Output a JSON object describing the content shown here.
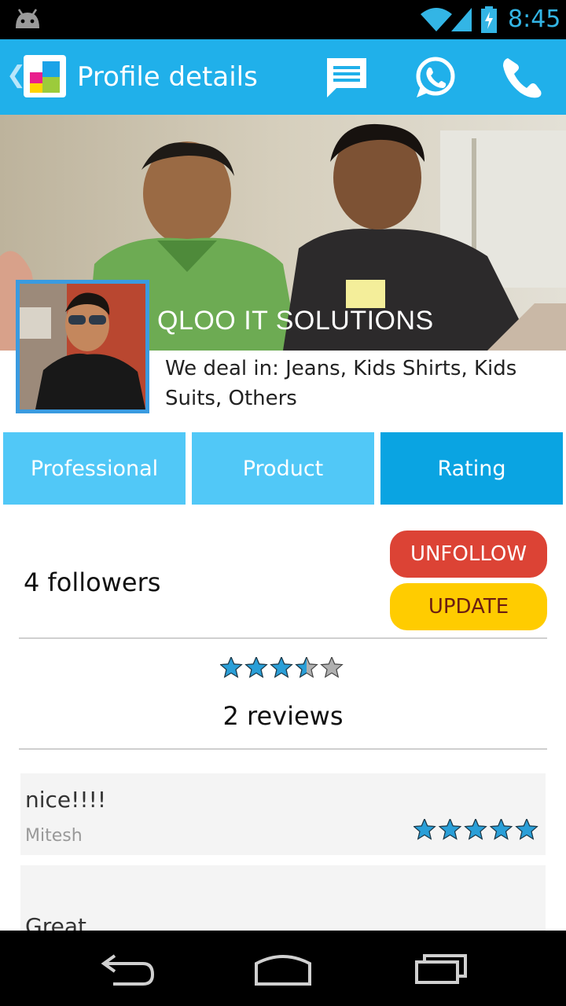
{
  "status_bar": {
    "time": "8:45"
  },
  "action_bar": {
    "back": "❮",
    "title": "Profile details",
    "icons": [
      "message-icon",
      "whatsapp-icon",
      "phone-icon"
    ]
  },
  "profile": {
    "company": "QLOO IT SOLUTIONS",
    "deals": "We deal in: Jeans, Kids Shirts, Kids Suits, Others"
  },
  "tabs": [
    {
      "label": "Professional",
      "active": false
    },
    {
      "label": "Product",
      "active": false
    },
    {
      "label": "Rating",
      "active": true
    }
  ],
  "followers": "4 followers",
  "buttons": {
    "unfollow": "UNFOLLOW",
    "update": "UPDATE"
  },
  "rating": {
    "stars": 3.5,
    "max": 5,
    "reviews": "2 reviews"
  },
  "review_list": [
    {
      "text": "nice!!!!",
      "author": "Mitesh",
      "stars": 5
    },
    {
      "text": "Great",
      "author": "",
      "stars": null
    }
  ],
  "colors": {
    "accent": "#20b0ea",
    "tab_inactive": "#51c8f7",
    "tab_active": "#0aa4e2",
    "unfollow": "#dc4335",
    "update": "#ffcc00",
    "star_fill": "#2a9fd8"
  }
}
